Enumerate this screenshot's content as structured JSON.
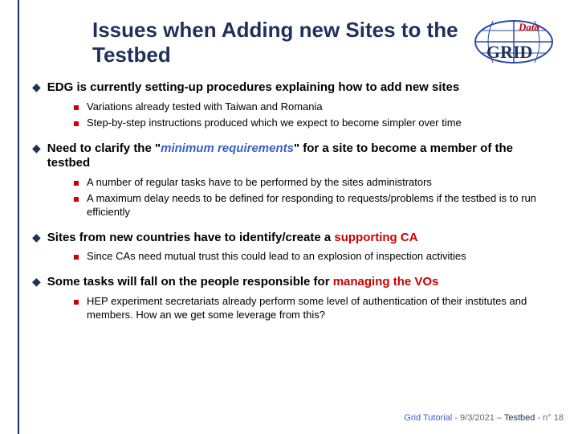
{
  "title": "Issues when Adding new Sites to the Testbed",
  "logo": {
    "word_data": "Data",
    "word_grid": "GRID"
  },
  "items": [
    {
      "text": "EDG is currently setting-up procedures explaining how to add new sites",
      "subs": [
        {
          "text": "Variations already tested with Taiwan and Romania"
        },
        {
          "text": "Step-by-step instructions produced which we expect to become simpler over time"
        }
      ]
    },
    {
      "pre": "Need to clarify the \"",
      "hi": "minimum requirements",
      "hi_class": "hi-blue",
      "post": "\" for a site to become a member of the testbed",
      "subs": [
        {
          "text": "A number of regular tasks have to be performed by the sites administrators"
        },
        {
          "text": "A maximum delay needs to be defined for responding to requests/problems if the testbed is to run efficiently"
        }
      ]
    },
    {
      "pre": "Sites from new countries have to identify/create a ",
      "hi": "supporting CA",
      "hi_class": "hi-red",
      "post": "",
      "subs": [
        {
          "text": "Since CAs need mutual trust this could lead to an explosion of inspection activities"
        }
      ]
    },
    {
      "pre": "Some tasks will fall on the people responsible for ",
      "hi": "managing the VOs",
      "hi_class": "hi-red",
      "post": "",
      "subs": [
        {
          "text": "HEP experiment secretariats already perform some level of authentication of their institutes and members. How an we get some leverage from this?"
        }
      ]
    }
  ],
  "footer": {
    "left": "Grid Tutorial ",
    "date": "- 9/3/2021 – ",
    "mid": "Testbed",
    "page": " - n° 18"
  }
}
